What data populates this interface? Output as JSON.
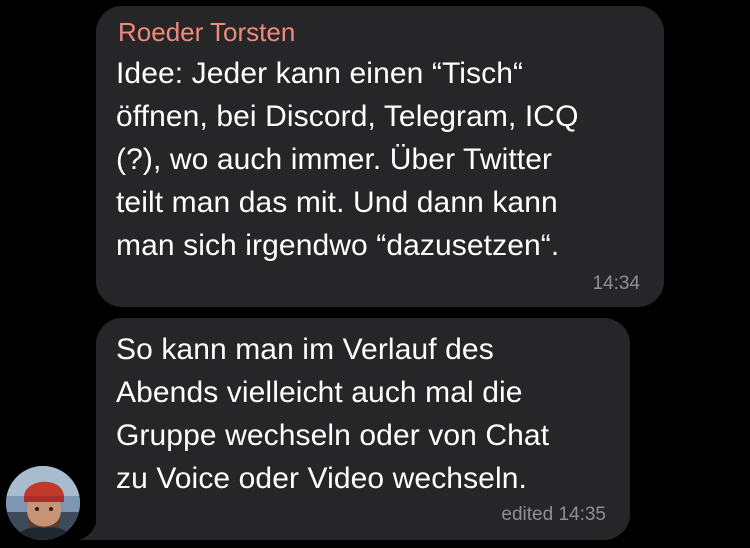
{
  "messages": [
    {
      "sender": "Roeder Torsten",
      "text": "Idee: Jeder kann einen “Tisch“\nöffnen, bei Discord, Telegram, ICQ\n(?), wo auch immer. Über Twitter\nteilt man das mit. Und dann kann\nman sich irgendwo “dazusetzen“.",
      "time": "14:34"
    },
    {
      "text": "So kann man im Verlauf des\nAbends vielleicht auch mal die\nGruppe wechseln oder von Chat\nzu Voice oder Video wechseln.",
      "time": "edited 14:35"
    }
  ],
  "colors": {
    "background": "#000000",
    "bubble": "#262628",
    "sender_name": "#ee8a7c",
    "message_text": "#ffffff",
    "timestamp": "#8e8e93"
  },
  "avatar": {
    "icon": "user-avatar-photo"
  }
}
